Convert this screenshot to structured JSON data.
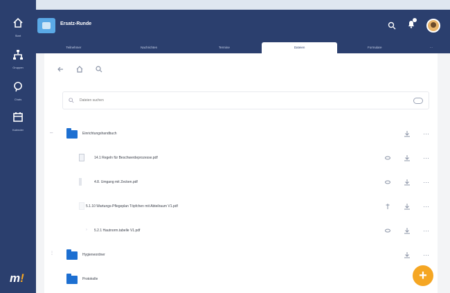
{
  "app": {
    "title": "Ersatz-Runde"
  },
  "sidebar": {
    "items": [
      {
        "label": "Start",
        "icon": "home-icon"
      },
      {
        "label": "Gruppen",
        "icon": "org-icon"
      },
      {
        "label": "Chats",
        "icon": "chat-icon"
      },
      {
        "label": "Kalender",
        "icon": "calendar-icon"
      }
    ],
    "logo": {
      "letter": "m",
      "mark": "!"
    }
  },
  "tabs": [
    {
      "label": "Teilnehmer"
    },
    {
      "label": "Nachrichten"
    },
    {
      "label": "Termine"
    },
    {
      "label": "Dateien"
    },
    {
      "label": "Formulare"
    },
    {
      "label": "⋯"
    }
  ],
  "active_tab": 3,
  "search": {
    "placeholder": "Dateien suchen"
  },
  "files": [
    {
      "type": "folder",
      "name": "Einrichtungshandbuch"
    },
    {
      "type": "file",
      "name": "14.1 Regeln für Beschwerdeprozesse.pdf"
    },
    {
      "type": "file",
      "name": "4.8. Umgang mit Zecken.pdf"
    },
    {
      "type": "file",
      "name": "5.1.10 Wartungs-Pflegeplan Töpfchen mit Abteilraum V1.pdf"
    },
    {
      "type": "file",
      "name": "5.2.1 Hautnorm.tabelle V1.pdf"
    },
    {
      "type": "folder",
      "name": "Hygieneordner"
    },
    {
      "type": "folder",
      "name": "Protokolle"
    }
  ],
  "colors": {
    "brand": "#2b3f6e",
    "accent": "#f5a623",
    "folder": "#1d6fd1"
  }
}
